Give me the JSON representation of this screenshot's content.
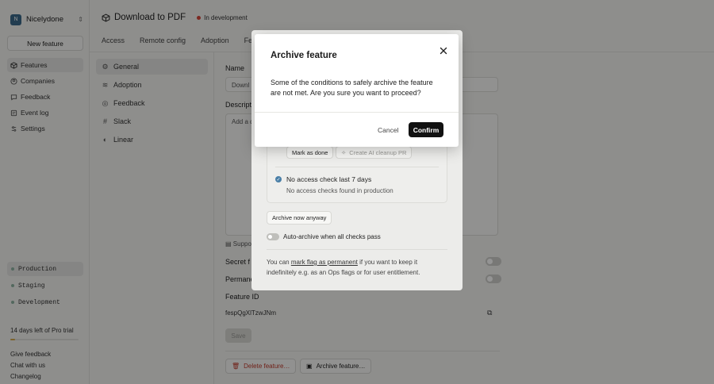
{
  "org": {
    "initial": "N",
    "name": "Nicelydone"
  },
  "sidebar": {
    "new_feature_label": "New feature",
    "nav": [
      {
        "label": "Features",
        "icon": "box-icon"
      },
      {
        "label": "Companies",
        "icon": "companies-icon"
      },
      {
        "label": "Feedback",
        "icon": "feedback-icon"
      },
      {
        "label": "Event log",
        "icon": "event-log-icon"
      },
      {
        "label": "Settings",
        "icon": "settings-icon"
      }
    ],
    "environments": [
      "Production",
      "Staging",
      "Development"
    ],
    "trial_text": "14 days left of Pro trial",
    "trial_progress": 0.07,
    "footer_links": [
      "Give feedback",
      "Chat with us",
      "Changelog"
    ]
  },
  "header": {
    "title": "Download to PDF",
    "status": "In development",
    "status_color": "#d6453a",
    "tabs": [
      "Access",
      "Remote config",
      "Adoption",
      "Fe"
    ]
  },
  "settings_nav": [
    {
      "label": "General",
      "icon": "gear-icon"
    },
    {
      "label": "Adoption",
      "icon": "adoption-icon"
    },
    {
      "label": "Feedback",
      "icon": "feedback-icon"
    },
    {
      "label": "Slack",
      "icon": "slack-icon"
    },
    {
      "label": "Linear",
      "icon": "linear-icon"
    }
  ],
  "form": {
    "name_label": "Name",
    "name_value": "Downl",
    "description_label": "Descript",
    "description_placeholder": "Add a d",
    "support_label": "Suppo",
    "secret_label": "Secret f",
    "permanent_label": "Permane",
    "feature_id_label": "Feature ID",
    "feature_id_value": "fespQgXlTzwJNm",
    "save_label": "Save",
    "delete_label": "Delete feature…",
    "archive_label": "Archive feature…"
  },
  "archive_panel": {
    "mark_done_label": "Mark as done",
    "cleanup_pr_label": "Create AI cleanup PR",
    "check_title": "No access check last 7 days",
    "check_subtitle": "No access checks found in production",
    "archive_now_label": "Archive now anyway",
    "auto_archive_label": "Auto-archive when all checks pass",
    "note_prefix": "You can ",
    "note_link": "mark flag as permanent",
    "note_suffix": " if you want to keep it indefinitely e.g. as an Ops flags or for user entitlement."
  },
  "modal": {
    "title": "Archive feature",
    "body": "Some of the conditions to safely archive the feature are not met. Are you sure you want to proceed?",
    "cancel_label": "Cancel",
    "confirm_label": "Confirm"
  }
}
